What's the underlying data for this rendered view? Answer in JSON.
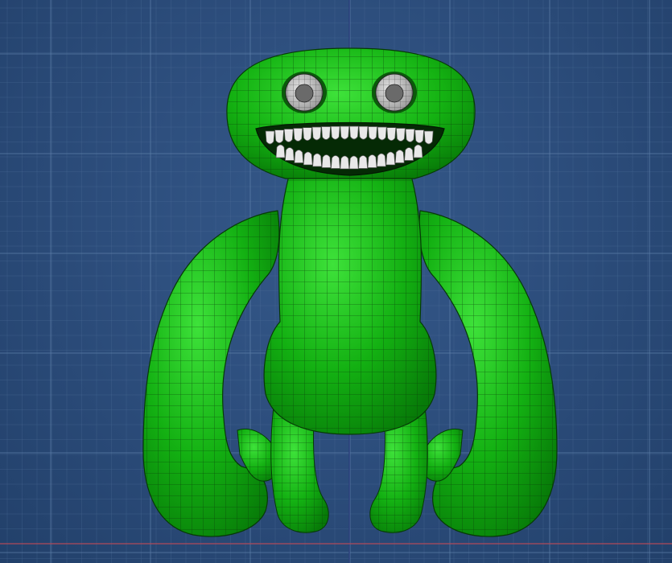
{
  "viewport": {
    "background": "#2d4e7d",
    "grid_color": "#4e6f98",
    "major_grid_color": "#5e80aa",
    "axis_y_color": "#2e4a86",
    "axis_x_color": "#b04a5a"
  },
  "model": {
    "body_color": "#13b012",
    "body_highlight": "#3ee23a",
    "body_shadow": "#077a08",
    "wire_color": "#0a3d0a",
    "teeth_color": "#e8e8e8",
    "eye_color": "#c9c9c9",
    "pupil_color": "#6a6a6a"
  }
}
